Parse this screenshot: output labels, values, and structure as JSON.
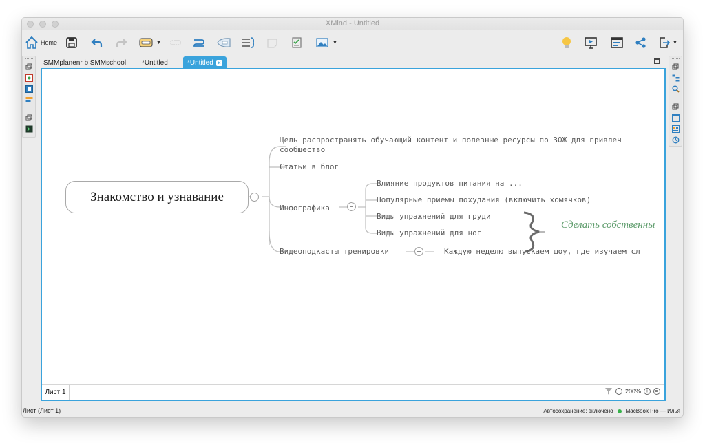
{
  "window": {
    "title": "XMind - Untitled"
  },
  "toolbar": {
    "home_label": "Home",
    "icons": [
      "home-icon",
      "save-icon",
      "undo-icon",
      "redo-icon",
      "topic-insert-icon",
      "relationship-icon",
      "boundary-icon",
      "summary-icon",
      "note-icon",
      "task-icon",
      "image-icon",
      "brainstorm-icon",
      "presentation-icon",
      "outline-icon",
      "share-icon",
      "export-icon"
    ]
  },
  "tabs": [
    {
      "label": "SMMplanenr b SMMschool",
      "active": false
    },
    {
      "label": "*Untitled",
      "active": false
    },
    {
      "label": "*Untitled",
      "active": true
    }
  ],
  "map": {
    "central": "Знакомство и узнавание",
    "branches": {
      "goal": "Цель распространять обучающий контент и полезные ресурсы по ЗОЖ для привлеч",
      "goal_cont": "сообщество",
      "blog": "Статьи в блог",
      "infographic": "Инфографика",
      "infographic_children": [
        "Влияние продуктов питания на ...",
        "Популярные приемы похудания (включить хомячков)",
        "Виды упражнений для груди",
        "Виды упражнений для ног"
      ],
      "video": "Видеоподкасты тренировки",
      "video_child": "Каждую неделю выпускаем шоу, где изучаем сл"
    },
    "summary": "Сделать собственны"
  },
  "sheet": {
    "tab": "Лист 1",
    "zoom": "200%"
  },
  "status": {
    "left": "Лист (Лист 1)",
    "autosave": "Автосохранение: включено",
    "user": "MacBook Pro — Илья"
  },
  "colors": {
    "accent": "#3aa3dc",
    "summary_text": "#5e9c6c",
    "status_ok": "#36b24a"
  }
}
